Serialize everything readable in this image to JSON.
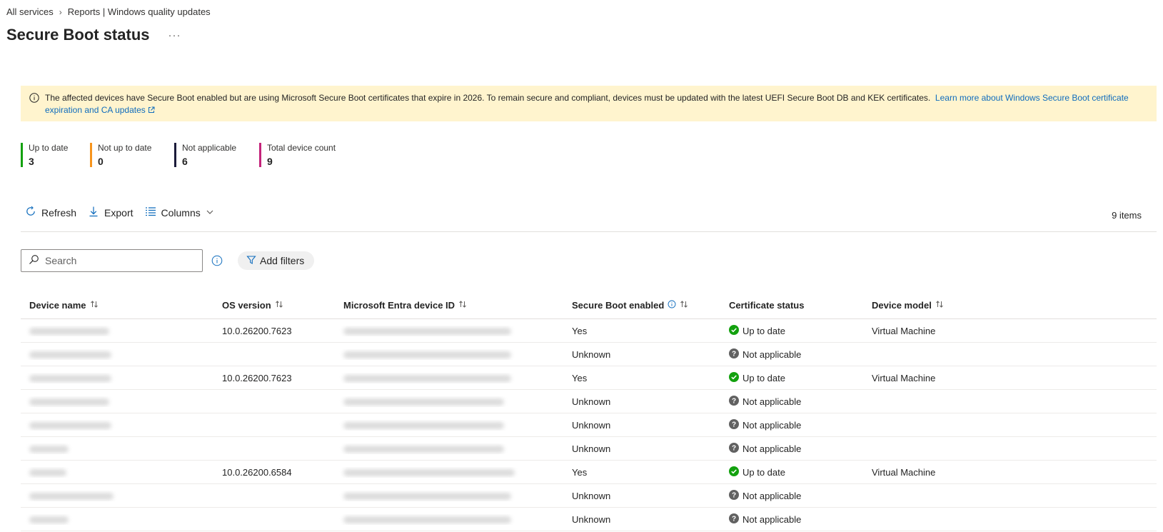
{
  "breadcrumb": {
    "item1": "All services",
    "separator": "›",
    "item2": "Reports | Windows quality updates"
  },
  "page": {
    "title": "Secure Boot status",
    "more": "···"
  },
  "banner": {
    "text": "The affected devices have Secure Boot enabled but are using Microsoft Secure Boot certificates that expire in 2026. To remain secure and compliant, devices must be updated with the latest UEFI Secure Boot DB and KEK certificates.",
    "link": "Learn more about Windows Secure Boot certificate expiration and CA updates",
    "bg_color": "#fff4ce"
  },
  "stats": [
    {
      "label": "Up to date",
      "value": "3",
      "color": "#13a10e"
    },
    {
      "label": "Not up to date",
      "value": "0",
      "color": "#f7941d"
    },
    {
      "label": "Not applicable",
      "value": "6",
      "color": "#1b1b3a"
    },
    {
      "label": "Total device count",
      "value": "9",
      "color": "#c4247b"
    }
  ],
  "toolbar": {
    "refresh": "Refresh",
    "export": "Export",
    "columns": "Columns",
    "items_count": "9 items"
  },
  "search": {
    "placeholder": "Search"
  },
  "filters": {
    "add": "Add filters"
  },
  "table": {
    "headers": {
      "device_name": "Device name",
      "os_version": "OS version",
      "entra_id": "Microsoft Entra device ID",
      "secure_boot": "Secure Boot enabled",
      "cert_status": "Certificate status",
      "device_model": "Device model"
    },
    "rows": [
      {
        "os": "10.0.26200.7623",
        "secure_boot": "Yes",
        "status": "Up to date",
        "status_type": "ok",
        "model": "Virtual Machine"
      },
      {
        "os": "",
        "secure_boot": "Unknown",
        "status": "Not applicable",
        "status_type": "na",
        "model": ""
      },
      {
        "os": "10.0.26200.7623",
        "secure_boot": "Yes",
        "status": "Up to date",
        "status_type": "ok",
        "model": "Virtual Machine"
      },
      {
        "os": "",
        "secure_boot": "Unknown",
        "status": "Not applicable",
        "status_type": "na",
        "model": ""
      },
      {
        "os": "",
        "secure_boot": "Unknown",
        "status": "Not applicable",
        "status_type": "na",
        "model": ""
      },
      {
        "os": "",
        "secure_boot": "Unknown",
        "status": "Not applicable",
        "status_type": "na",
        "model": ""
      },
      {
        "os": "10.0.26200.6584",
        "secure_boot": "Yes",
        "status": "Up to date",
        "status_type": "ok",
        "model": "Virtual Machine"
      },
      {
        "os": "",
        "secure_boot": "Unknown",
        "status": "Not applicable",
        "status_type": "na",
        "model": ""
      },
      {
        "os": "",
        "secure_boot": "Unknown",
        "status": "Not applicable",
        "status_type": "na",
        "model": ""
      }
    ]
  },
  "colors": {
    "accent": "#0f6cbd",
    "ok_green": "#13a10e",
    "na_gray": "#616161"
  }
}
